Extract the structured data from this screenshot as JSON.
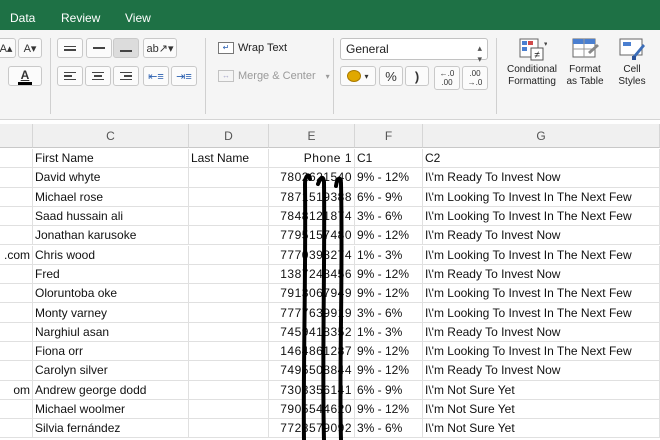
{
  "menu": {
    "data": "Data",
    "review": "Review",
    "view": "View"
  },
  "ribbon": {
    "font_size_up": "A▴",
    "font_size_down": "A▾",
    "font_color_letter": "A",
    "wrap_text": "Wrap Text",
    "merge_center": "Merge & Center",
    "number_format": "General",
    "percent": "%",
    "comma": ")",
    "inc_decimal": "←.0\n.00",
    "dec_decimal": ".00\n→.0",
    "conditional_formatting": "Conditional Formatting",
    "format_as_table": "Format as Table",
    "cell_styles": "Cell Styles",
    "accent_color": "#1e7145"
  },
  "columns": [
    "C",
    "D",
    "E",
    "F",
    "G"
  ],
  "header_row": {
    "b": "",
    "c": "First Name",
    "d": "Last Name",
    "e": "Phone 1",
    "f": "C1",
    "g": "C2"
  },
  "rows": [
    {
      "b": "",
      "c": "David whyte",
      "d": "",
      "e": "7802621540",
      "f": "9% - 12%",
      "g": "I\\'m Ready To Invest Now"
    },
    {
      "b": "",
      "c": "Michael rose",
      "d": "",
      "e": "7871519388",
      "f": "6% - 9%",
      "g": "I\\'m Looking To Invest In The Next Few"
    },
    {
      "b": "",
      "c": "Saad hussain ali",
      "d": "",
      "e": "7848121874",
      "f": "3% - 6%",
      "g": "I\\'m Looking To Invest In The Next Few"
    },
    {
      "b": "",
      "c": "Jonathan karusoke",
      "d": "",
      "e": "7795157480",
      "f": "9% - 12%",
      "g": "I\\'m Ready To Invest Now"
    },
    {
      "b": ".com",
      "c": "Chris wood",
      "d": "",
      "e": "7770398274",
      "f": "1% - 3%",
      "g": "I\\'m Looking To Invest In The Next Few"
    },
    {
      "b": "",
      "c": "Fred",
      "d": "",
      "e": "1387248456",
      "f": "9% - 12%",
      "g": "I\\'m Ready To Invest Now"
    },
    {
      "b": "",
      "c": "Oloruntoba oke",
      "d": "",
      "e": "7913067949",
      "f": "9% - 12%",
      "g": "I\\'m Looking To Invest In The Next Few"
    },
    {
      "b": "",
      "c": "Monty varney",
      "d": "",
      "e": "7777639919",
      "f": "3% - 6%",
      "g": "I\\'m Looking To Invest In The Next Few"
    },
    {
      "b": "",
      "c": "Narghiul asan",
      "d": "",
      "e": "7459418352",
      "f": "1% - 3%",
      "g": "I\\'m Ready To Invest Now"
    },
    {
      "b": "",
      "c": "Fiona orr",
      "d": "",
      "e": "1464861287",
      "f": "9% - 12%",
      "g": "I\\'m Looking To Invest In The Next Few"
    },
    {
      "b": "",
      "c": "Carolyn silver",
      "d": "",
      "e": "7495508844",
      "f": "9% - 12%",
      "g": "I\\'m Ready To Invest Now"
    },
    {
      "b": "om",
      "c": "Andrew george dodd",
      "d": "",
      "e": "7303356141",
      "f": "6% - 9%",
      "g": "I\\'m Not Sure Yet"
    },
    {
      "b": "",
      "c": "Michael woolmer",
      "d": "",
      "e": "7905544620",
      "f": "9% - 12%",
      "g": "I\\'m Not Sure Yet"
    },
    {
      "b": "",
      "c": "Silvia fernández",
      "d": "",
      "e": "7728579092",
      "f": "3% - 6%",
      "g": "I\\'m Not Sure Yet"
    }
  ]
}
